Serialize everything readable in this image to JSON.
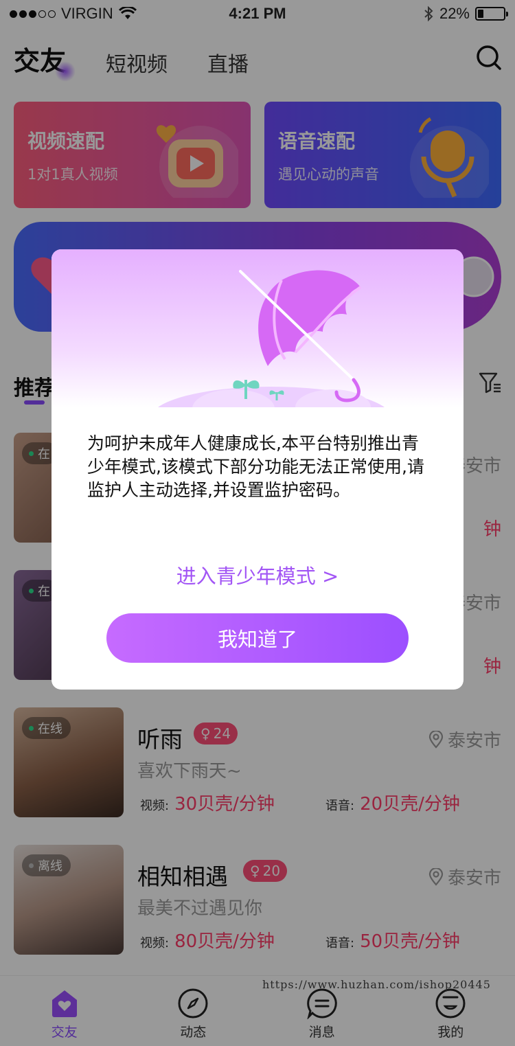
{
  "status_bar": {
    "carrier": "VIRGIN",
    "time": "4:21 PM",
    "battery": "22%",
    "battery_level": 0.22
  },
  "top_tabs": [
    {
      "label": "交友",
      "active": true
    },
    {
      "label": "短视频",
      "active": false
    },
    {
      "label": "直播",
      "active": false
    }
  ],
  "feature_cards": {
    "video": {
      "title": "视频速配",
      "subtitle": "1对1真人视频"
    },
    "voice": {
      "title": "语音速配",
      "subtitle": "遇见心动的声音"
    }
  },
  "recommend": {
    "title": "推荐"
  },
  "users": [
    {
      "status": "在线",
      "online": true,
      "name": "听雨",
      "age": "24",
      "location": "泰安市",
      "signature": "喜欢下雨天~",
      "video_label": "视频:",
      "video_price": "30贝壳/分钟",
      "voice_label": "语音:",
      "voice_price": "20贝壳/分钟"
    },
    {
      "status": "离线",
      "online": false,
      "name": "相知相遇",
      "age": "20",
      "location": "泰安市",
      "signature": "最美不过遇见你",
      "video_label": "视频:",
      "video_price": "80贝壳/分钟",
      "voice_label": "语音:",
      "voice_price": "50贝壳/分钟"
    }
  ],
  "hidden_rows": [
    {
      "status": "在",
      "location": "泰安市",
      "price_tail": "钟"
    },
    {
      "status": "在",
      "location": "泰安市",
      "price_tail": "钟"
    }
  ],
  "bottom_nav": [
    {
      "label": "交友",
      "icon": "home-heart-icon",
      "active": true
    },
    {
      "label": "动态",
      "icon": "compass-icon",
      "active": false
    },
    {
      "label": "消息",
      "icon": "message-icon",
      "active": false
    },
    {
      "label": "我的",
      "icon": "smile-face-icon",
      "active": false
    }
  ],
  "watermark": "https://www.huzhan.com/ishop20445",
  "dialog": {
    "message": "为呵护未成年人健康成长,本平台特别推出青少年模式,该模式下部分功能无法正常使用,请监护人主动选择,并设置监护密码。",
    "link_label": "进入青少年模式 >",
    "button_label": "我知道了"
  },
  "colors": {
    "accent": "#9c4fff",
    "price": "#ff3d6a",
    "age_badge": "#ff4f78",
    "online": "#2ee08e"
  }
}
